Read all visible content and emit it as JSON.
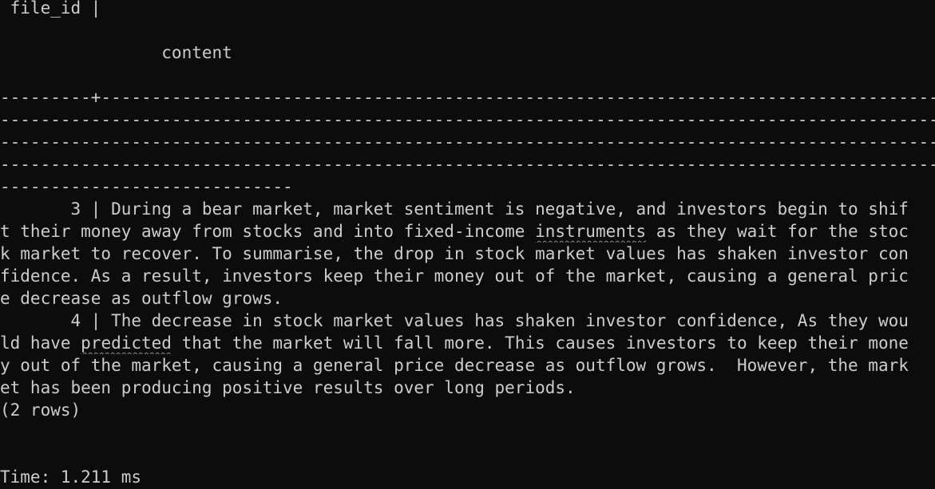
{
  "terminal": {
    "header": {
      "col1": " file_id |",
      "col2": "                content"
    },
    "separator": [
      "---------+-------------------------------------------------------------------------------------------------------------------------------------",
      "------------------------------------------------------------------------------------------------------------------------------------------------------",
      "------------------------------------------------------------------------------------------------------------------------------------------------------",
      "------------------------------------------------------------------------------------------------------------------------------------------------------",
      "-----------------------------"
    ],
    "rows": [
      {
        "lines": [
          "       3 | During a bear market, market sentiment is negative, and investors begin to shif",
          "t their money away from stocks and into fixed-income ",
          "k market to recover. To summarise, the drop in stock market values has shaken investor con",
          "fidence. As a result, investors keep their money out of the market, causing a general pric",
          "e decrease as outflow grows."
        ],
        "flagged_word": "instruments",
        "line2_after": " as they wait for the stoc"
      },
      {
        "lines": [
          "       4 | The decrease in stock market values has shaken investor confidence, As they wou",
          "ld have ",
          "y out of the market, causing a general price decrease as outflow grows.  However, the mark",
          "et has been producing positive results over long periods."
        ],
        "flagged_word": "predicted",
        "line2_after": " that the market will fall more. This causes investors to keep their mone"
      }
    ],
    "row_count": "(2 rows)",
    "timing": "Time: 1.211 ms"
  }
}
